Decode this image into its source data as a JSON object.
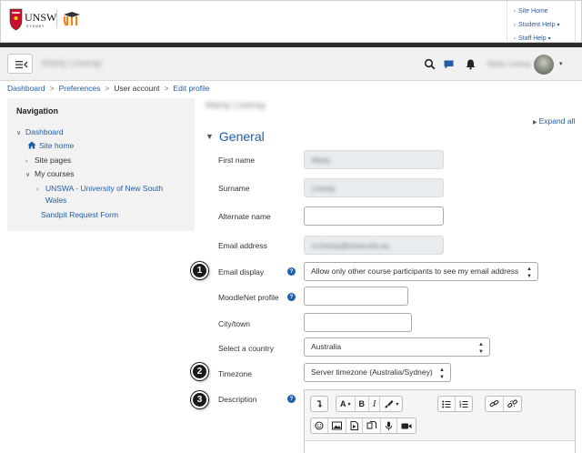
{
  "brand": {
    "logo_text": "UNSW",
    "logo_sub": "SYDNEY",
    "links": [
      {
        "label": "Site Home",
        "dropdown": false
      },
      {
        "label": "Student Help",
        "dropdown": true
      },
      {
        "label": "Staff Help",
        "dropdown": true
      }
    ]
  },
  "navbar": {
    "icons": [
      "menu-icon",
      "search-icon",
      "chat-icon",
      "bell-icon"
    ]
  },
  "breadcrumb": {
    "items": [
      "Dashboard",
      "Preferences",
      "User account",
      "Edit profile"
    ]
  },
  "navigation": {
    "title": "Navigation",
    "items": [
      {
        "label": "Dashboard",
        "link": true
      },
      {
        "label": "Site home",
        "link": true
      },
      {
        "label": "Site pages",
        "link": false
      },
      {
        "label": "My courses",
        "link": false
      },
      {
        "label": "UNSWA - University of New South",
        "link": true
      },
      {
        "label": "Wales",
        "link": true
      },
      {
        "label": "Sandpit Request Form",
        "link": true
      }
    ]
  },
  "form": {
    "expand_all": "Expand all",
    "section": "General",
    "fields": {
      "first_name": "First name",
      "surname": "Surname",
      "alternate_name": "Alternate name",
      "email_address": "Email address",
      "email_display": "Email display",
      "moodlenet_profile": "MoodleNet profile",
      "city_town": "City/town",
      "select_country": "Select a country",
      "timezone": "Timezone",
      "description": "Description"
    },
    "values": {
      "email_display": "Allow only other course participants to see my email address",
      "country": "Australia",
      "timezone": "Server timezone (Australia/Sydney)"
    }
  },
  "markers": [
    "1",
    "2",
    "3"
  ],
  "editor": {
    "toolbar_row1": [
      "collapse-icon",
      "font-style-icon",
      "bold-icon",
      "italic-icon",
      "paint-brush-icon",
      "bullet-list-icon",
      "numbered-list-icon",
      "link-icon",
      "unlink-icon"
    ],
    "toolbar_row2": [
      "emoji-icon",
      "image-icon",
      "media-icon",
      "manage-files-icon",
      "record-audio-icon",
      "record-video-icon"
    ],
    "labels": {
      "bold": "B",
      "italic": "I",
      "font": "A"
    }
  },
  "colors": {
    "link": "#1f5ea8",
    "help": "#1f5ea8",
    "marker": "#1a1a1a",
    "nav_bg": "#f2f2f2"
  }
}
